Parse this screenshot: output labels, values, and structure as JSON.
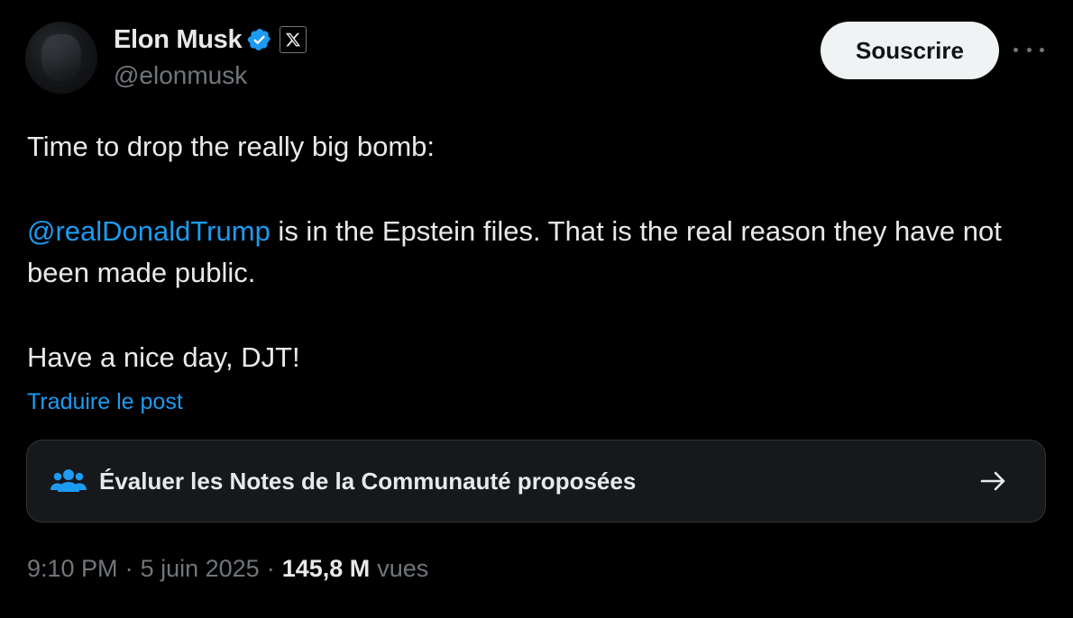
{
  "author": {
    "display_name": "Elon Musk",
    "handle": "@elonmusk",
    "avatar_icon": "profile-avatar",
    "verified_icon": "verified-badge-icon",
    "affiliate_icon": "x-logo-icon"
  },
  "header": {
    "subscribe_label": "Souscrire",
    "more_icon": "more-options-icon"
  },
  "tweet": {
    "line1": "Time to drop the really big bomb:",
    "mention": "@realDonaldTrump",
    "line2_rest": " is in the Epstein files. That is the real reason they have not been made public.",
    "line3": "Have a nice day, DJT!",
    "translate_label": "Traduire le post"
  },
  "community_notes": {
    "label": "Évaluer les Notes de la Communauté proposées",
    "icon": "people-group-icon",
    "arrow_icon": "arrow-right-icon"
  },
  "meta": {
    "time": "9:10 PM",
    "separator": "·",
    "date": "5 juin 2025",
    "views_count": "145,8 M",
    "views_label": "vues"
  },
  "colors": {
    "background": "#000000",
    "text_primary": "#e7e9ea",
    "text_secondary": "#71767b",
    "accent": "#1d9bf0",
    "button_bg": "#eff3f4"
  }
}
